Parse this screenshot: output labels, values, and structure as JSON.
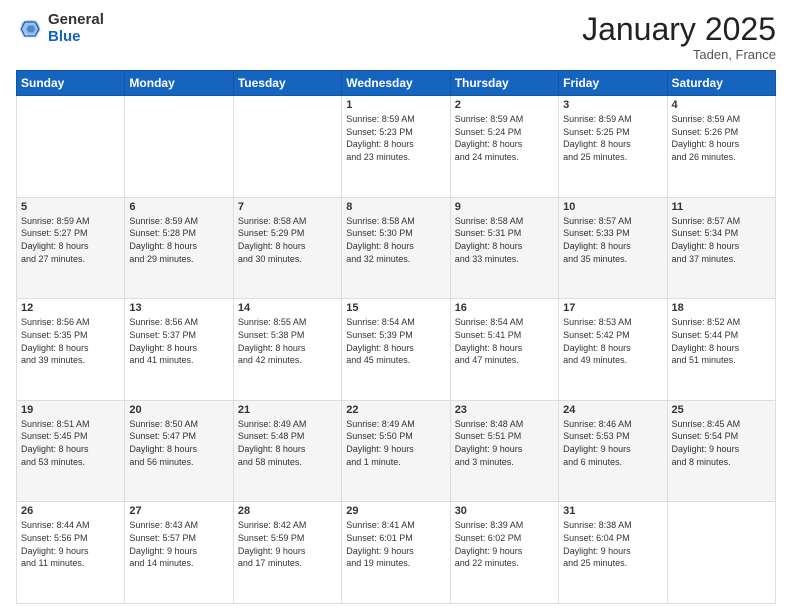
{
  "header": {
    "logo": {
      "general": "General",
      "blue": "Blue"
    },
    "title": "January 2025",
    "subtitle": "Taden, France"
  },
  "weekdays": [
    "Sunday",
    "Monday",
    "Tuesday",
    "Wednesday",
    "Thursday",
    "Friday",
    "Saturday"
  ],
  "weeks": [
    [
      {
        "day": "",
        "info": ""
      },
      {
        "day": "",
        "info": ""
      },
      {
        "day": "",
        "info": ""
      },
      {
        "day": "1",
        "info": "Sunrise: 8:59 AM\nSunset: 5:23 PM\nDaylight: 8 hours\nand 23 minutes."
      },
      {
        "day": "2",
        "info": "Sunrise: 8:59 AM\nSunset: 5:24 PM\nDaylight: 8 hours\nand 24 minutes."
      },
      {
        "day": "3",
        "info": "Sunrise: 8:59 AM\nSunset: 5:25 PM\nDaylight: 8 hours\nand 25 minutes."
      },
      {
        "day": "4",
        "info": "Sunrise: 8:59 AM\nSunset: 5:26 PM\nDaylight: 8 hours\nand 26 minutes."
      }
    ],
    [
      {
        "day": "5",
        "info": "Sunrise: 8:59 AM\nSunset: 5:27 PM\nDaylight: 8 hours\nand 27 minutes."
      },
      {
        "day": "6",
        "info": "Sunrise: 8:59 AM\nSunset: 5:28 PM\nDaylight: 8 hours\nand 29 minutes."
      },
      {
        "day": "7",
        "info": "Sunrise: 8:58 AM\nSunset: 5:29 PM\nDaylight: 8 hours\nand 30 minutes."
      },
      {
        "day": "8",
        "info": "Sunrise: 8:58 AM\nSunset: 5:30 PM\nDaylight: 8 hours\nand 32 minutes."
      },
      {
        "day": "9",
        "info": "Sunrise: 8:58 AM\nSunset: 5:31 PM\nDaylight: 8 hours\nand 33 minutes."
      },
      {
        "day": "10",
        "info": "Sunrise: 8:57 AM\nSunset: 5:33 PM\nDaylight: 8 hours\nand 35 minutes."
      },
      {
        "day": "11",
        "info": "Sunrise: 8:57 AM\nSunset: 5:34 PM\nDaylight: 8 hours\nand 37 minutes."
      }
    ],
    [
      {
        "day": "12",
        "info": "Sunrise: 8:56 AM\nSunset: 5:35 PM\nDaylight: 8 hours\nand 39 minutes."
      },
      {
        "day": "13",
        "info": "Sunrise: 8:56 AM\nSunset: 5:37 PM\nDaylight: 8 hours\nand 41 minutes."
      },
      {
        "day": "14",
        "info": "Sunrise: 8:55 AM\nSunset: 5:38 PM\nDaylight: 8 hours\nand 42 minutes."
      },
      {
        "day": "15",
        "info": "Sunrise: 8:54 AM\nSunset: 5:39 PM\nDaylight: 8 hours\nand 45 minutes."
      },
      {
        "day": "16",
        "info": "Sunrise: 8:54 AM\nSunset: 5:41 PM\nDaylight: 8 hours\nand 47 minutes."
      },
      {
        "day": "17",
        "info": "Sunrise: 8:53 AM\nSunset: 5:42 PM\nDaylight: 8 hours\nand 49 minutes."
      },
      {
        "day": "18",
        "info": "Sunrise: 8:52 AM\nSunset: 5:44 PM\nDaylight: 8 hours\nand 51 minutes."
      }
    ],
    [
      {
        "day": "19",
        "info": "Sunrise: 8:51 AM\nSunset: 5:45 PM\nDaylight: 8 hours\nand 53 minutes."
      },
      {
        "day": "20",
        "info": "Sunrise: 8:50 AM\nSunset: 5:47 PM\nDaylight: 8 hours\nand 56 minutes."
      },
      {
        "day": "21",
        "info": "Sunrise: 8:49 AM\nSunset: 5:48 PM\nDaylight: 8 hours\nand 58 minutes."
      },
      {
        "day": "22",
        "info": "Sunrise: 8:49 AM\nSunset: 5:50 PM\nDaylight: 9 hours\nand 1 minute."
      },
      {
        "day": "23",
        "info": "Sunrise: 8:48 AM\nSunset: 5:51 PM\nDaylight: 9 hours\nand 3 minutes."
      },
      {
        "day": "24",
        "info": "Sunrise: 8:46 AM\nSunset: 5:53 PM\nDaylight: 9 hours\nand 6 minutes."
      },
      {
        "day": "25",
        "info": "Sunrise: 8:45 AM\nSunset: 5:54 PM\nDaylight: 9 hours\nand 8 minutes."
      }
    ],
    [
      {
        "day": "26",
        "info": "Sunrise: 8:44 AM\nSunset: 5:56 PM\nDaylight: 9 hours\nand 11 minutes."
      },
      {
        "day": "27",
        "info": "Sunrise: 8:43 AM\nSunset: 5:57 PM\nDaylight: 9 hours\nand 14 minutes."
      },
      {
        "day": "28",
        "info": "Sunrise: 8:42 AM\nSunset: 5:59 PM\nDaylight: 9 hours\nand 17 minutes."
      },
      {
        "day": "29",
        "info": "Sunrise: 8:41 AM\nSunset: 6:01 PM\nDaylight: 9 hours\nand 19 minutes."
      },
      {
        "day": "30",
        "info": "Sunrise: 8:39 AM\nSunset: 6:02 PM\nDaylight: 9 hours\nand 22 minutes."
      },
      {
        "day": "31",
        "info": "Sunrise: 8:38 AM\nSunset: 6:04 PM\nDaylight: 9 hours\nand 25 minutes."
      },
      {
        "day": "",
        "info": ""
      }
    ]
  ]
}
